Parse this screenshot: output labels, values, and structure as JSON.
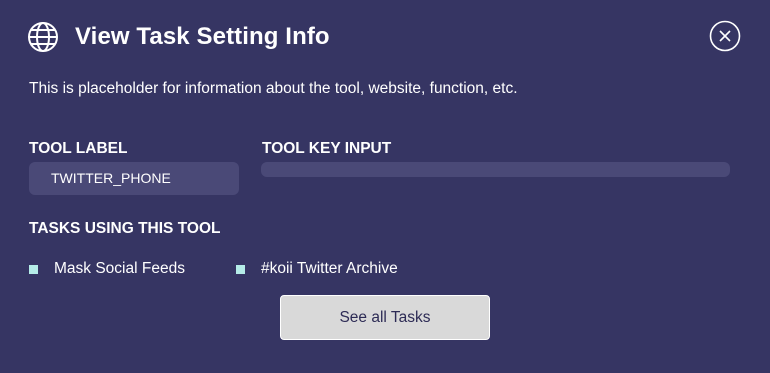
{
  "header": {
    "title": "View Task Setting Info",
    "icon": "globe-icon",
    "close_icon": "close-icon"
  },
  "description": "This is placeholder for information about the tool, website, function, etc.",
  "tool_label": {
    "heading": "TOOL LABEL",
    "value": "TWITTER_PHONE"
  },
  "tool_key_input": {
    "heading": "TOOL KEY INPUT",
    "value": ""
  },
  "tasks": {
    "heading": "TASKS USING THIS TOOL",
    "items": [
      {
        "label": "Mask Social Feeds"
      },
      {
        "label": "#koii Twitter Archive"
      }
    ],
    "bullet_color": "#b5ece8"
  },
  "see_all_button": {
    "label": "See all Tasks"
  },
  "colors": {
    "background": "#363563",
    "field": "#4a4977",
    "button": "#d9d9d9",
    "button_text": "#2d2b55"
  }
}
